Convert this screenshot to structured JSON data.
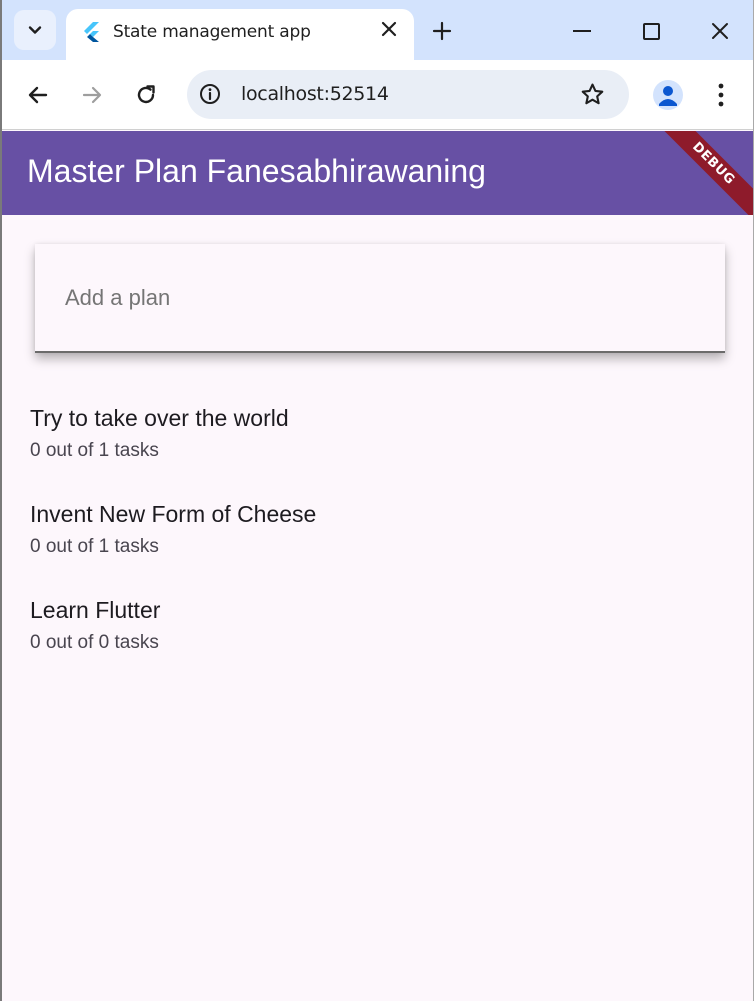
{
  "browser": {
    "tab_title": "State management app",
    "url": "localhost:52514"
  },
  "app": {
    "title": "Master Plan Fanesabhirawaning",
    "debug_label": "DEBUG",
    "add_plan_placeholder": "Add a plan",
    "plans": [
      {
        "title": "Try to take over the world",
        "subtitle": "0 out of 1 tasks"
      },
      {
        "title": "Invent New Form of Cheese",
        "subtitle": "0 out of 1 tasks"
      },
      {
        "title": "Learn Flutter",
        "subtitle": "0 out of 0 tasks"
      }
    ]
  },
  "colors": {
    "appbar": "#6750a4",
    "background": "#fdf7fc",
    "debug_banner": "#8e1b2b"
  },
  "icons": {
    "tab_search": "chevron-down-icon",
    "favicon": "flutter-logo-icon",
    "tab_close": "close-icon",
    "new_tab": "plus-icon",
    "back": "arrow-left-icon",
    "forward": "arrow-right-icon",
    "reload": "reload-icon",
    "site_info": "info-icon",
    "bookmark": "star-icon",
    "profile": "person-icon",
    "menu": "more-vert-icon"
  }
}
